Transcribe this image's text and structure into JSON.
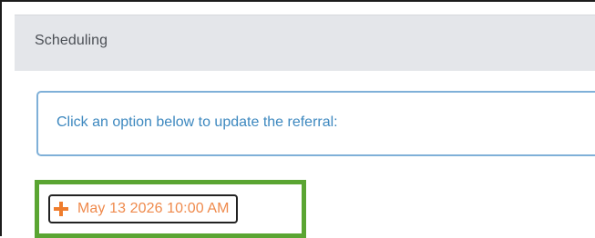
{
  "panel": {
    "title": "Scheduling"
  },
  "info": {
    "message": "Click an option below to update the referral:"
  },
  "options": [
    {
      "label": "May 13 2026 10:00 AM",
      "icon": "plus-icon"
    }
  ],
  "colors": {
    "header_bg": "#e4e6ea",
    "info_border": "#7fb0d8",
    "info_text": "#3d88bf",
    "option_text": "#ef8a4c",
    "highlight_border": "#5aa532"
  }
}
